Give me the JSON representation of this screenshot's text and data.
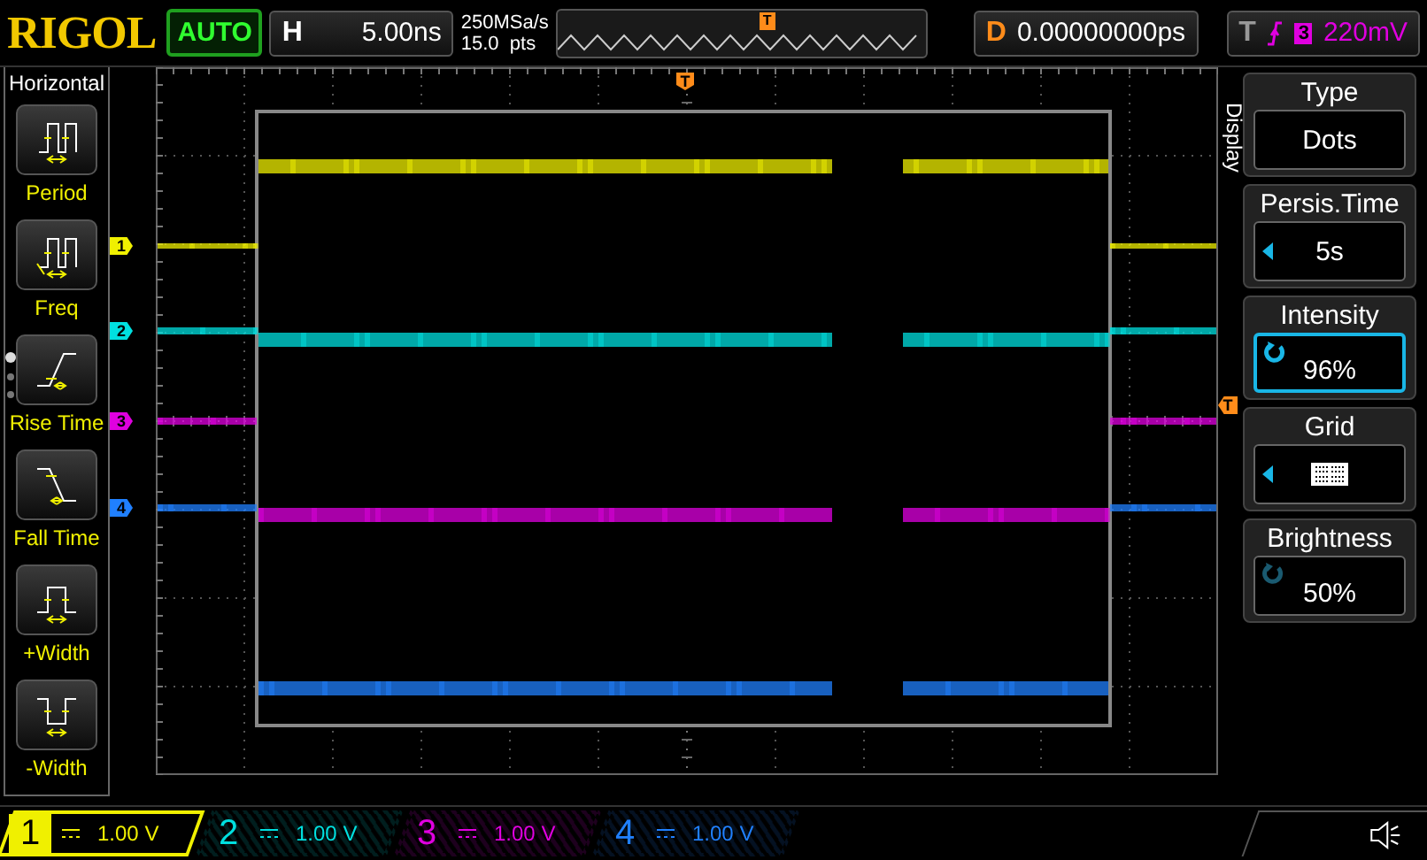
{
  "brand": "RIGOL",
  "run_status": "AUTO",
  "horizontal": {
    "label": "H",
    "timebase": "5.00ns",
    "sample_rate": "250MSa/s",
    "memory": "15.0  pts",
    "trigger_marker": "T"
  },
  "delay": {
    "label": "D",
    "value": "0.00000000ps"
  },
  "trigger": {
    "label": "T",
    "source": "3",
    "level": "220mV",
    "color": "#e000e0"
  },
  "measure_menu": {
    "title": "Horizontal",
    "items": [
      {
        "label": "Period",
        "kind": "period"
      },
      {
        "label": "Freq",
        "kind": "freq"
      },
      {
        "label": "Rise Time",
        "kind": "rise"
      },
      {
        "label": "Fall Time",
        "kind": "fall"
      },
      {
        "label": "+Width",
        "kind": "pwidth"
      },
      {
        "label": "-Width",
        "kind": "nwidth"
      }
    ]
  },
  "trigger_markers": [
    "T",
    "T"
  ],
  "display_menu": {
    "title": "Display",
    "items": [
      {
        "label": "Type",
        "value": "Dots",
        "kind": "text",
        "selected": false
      },
      {
        "label": "Persis.Time",
        "value": "5s",
        "kind": "arrow",
        "selected": false
      },
      {
        "label": "Intensity",
        "value": "96%",
        "kind": "knob",
        "selected": true
      },
      {
        "label": "Grid",
        "kind": "grid",
        "selected": false
      },
      {
        "label": "Brightness",
        "value": "50%",
        "kind": "knob",
        "selected": false
      }
    ]
  },
  "channels": [
    {
      "marker": "1",
      "number": "1",
      "scale": "1.00 V",
      "color": "#f0f000",
      "selected": true
    },
    {
      "marker": "2",
      "number": "2",
      "scale": "1.00 V",
      "color": "#00e0e0",
      "selected": false
    },
    {
      "marker": "3",
      "number": "3",
      "scale": "1.00 V",
      "color": "#e000e0",
      "selected": false
    },
    {
      "marker": "4",
      "number": "4",
      "scale": "1.00 V",
      "color": "#2080ff",
      "selected": false
    }
  ]
}
